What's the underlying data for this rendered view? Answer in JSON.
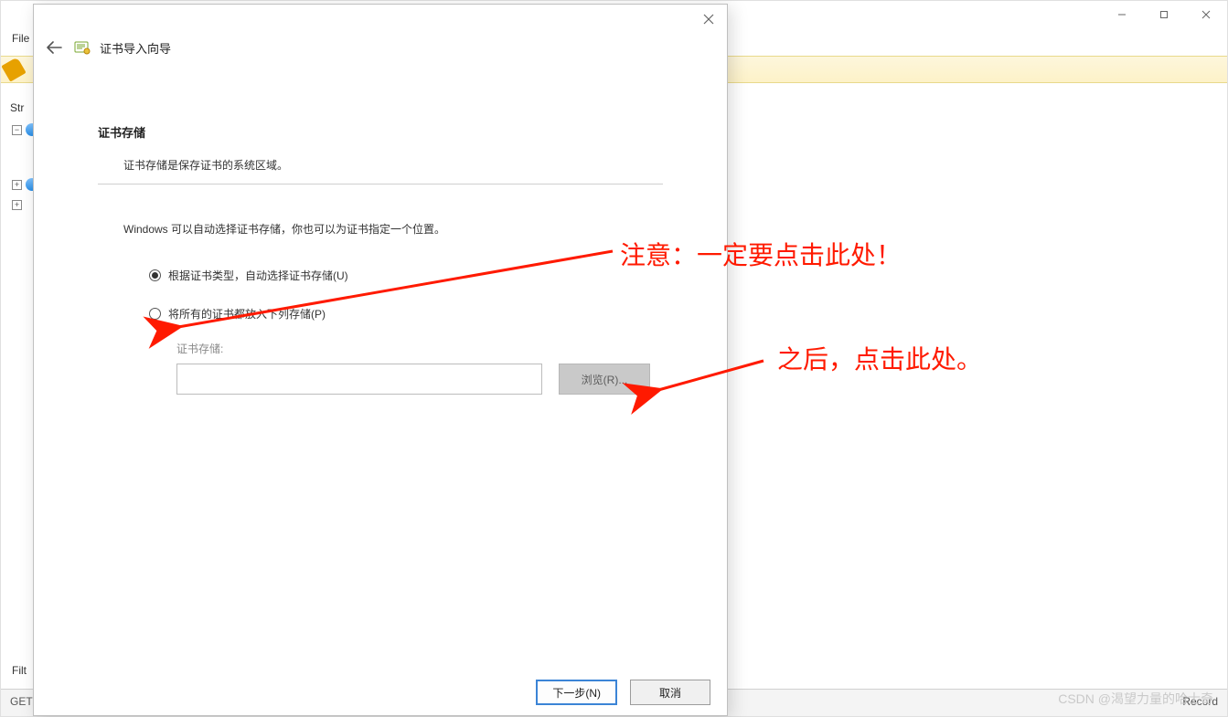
{
  "bg": {
    "file_menu": "File",
    "left_panel_label": "Str",
    "filter_label": "Filt",
    "get_label": "GET",
    "record_label": "Record"
  },
  "wizard": {
    "title": "证书导入向导",
    "section_title": "证书存储",
    "section_desc": "证书存储是保存证书的系统区域。",
    "info_text": "Windows 可以自动选择证书存储，你也可以为证书指定一个位置。",
    "radio_auto": "根据证书类型，自动选择证书存储(U)",
    "radio_manual": "将所有的证书都放入下列存储(P)",
    "store_label": "证书存储:",
    "store_value": "",
    "browse_btn": "浏览(R)...",
    "next_btn": "下一步(N)",
    "cancel_btn": "取消",
    "radio_selected": "auto"
  },
  "annotations": {
    "note1": "注意：一定要点击此处！",
    "note2": "之后，点击此处。"
  },
  "watermark": "CSDN @渴望力量的哈士奇"
}
